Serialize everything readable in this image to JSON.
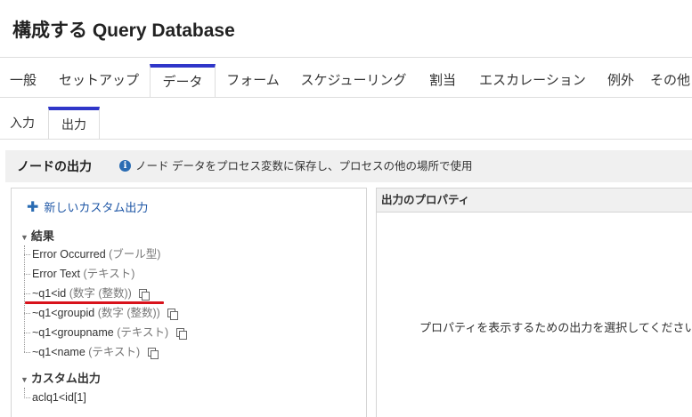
{
  "page_title": "構成する Query Database",
  "tabs": [
    {
      "label": "一般"
    },
    {
      "label": "セットアップ"
    },
    {
      "label": "データ"
    },
    {
      "label": "フォーム"
    },
    {
      "label": "スケジューリング"
    },
    {
      "label": "割当"
    },
    {
      "label": "エスカレーション"
    },
    {
      "label": "例外"
    },
    {
      "label": "その他"
    }
  ],
  "active_tab": "データ",
  "subtabs": [
    {
      "label": "入力"
    },
    {
      "label": "出力"
    }
  ],
  "active_subtab": "出力",
  "toolbar": {
    "title": "ノードの出力",
    "info_icon": "i",
    "hint": "ノード データをプロセス変数に保存し、プロセスの他の場所で使用"
  },
  "left_panel": {
    "add_label": "新しいカスタム出力",
    "results_section": "結果",
    "results": [
      {
        "name": "Error Occurred",
        "type": "(ブール型)"
      },
      {
        "name": "Error Text",
        "type": "(テキスト)"
      },
      {
        "name": "~q1<id",
        "type": "(数字 (整数))"
      },
      {
        "name": "~q1<groupid",
        "type": "(数字 (整数))"
      },
      {
        "name": "~q1<groupname",
        "type": "(テキスト)"
      },
      {
        "name": "~q1<name",
        "type": "(テキスト)"
      }
    ],
    "custom_section": "カスタム出力",
    "custom": [
      {
        "name": "aclq1<id[1]"
      }
    ]
  },
  "right_panel": {
    "header": "出力のプロパティ",
    "empty_message": "プロパティを表示するための出力を選択してください。"
  },
  "colors": {
    "accent": "#2f36c9",
    "link": "#1f57a6",
    "highlight": "#d8121b",
    "toolbar_bg": "#f0f0f0"
  }
}
